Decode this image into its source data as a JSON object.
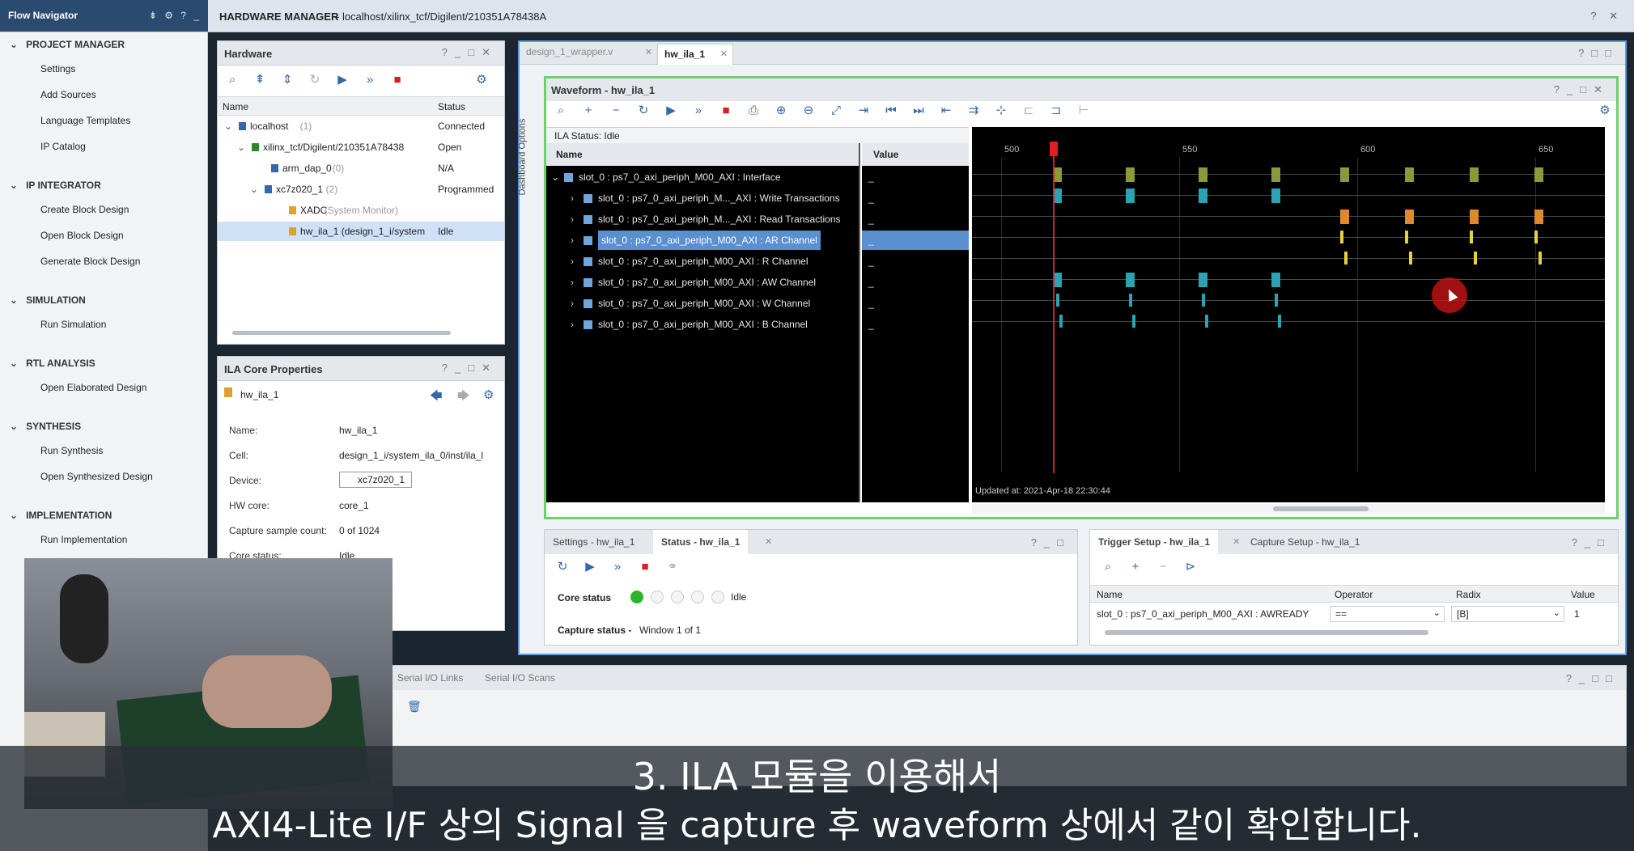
{
  "app": {
    "title_prefix": "HARDWARE MANAGER",
    "title_path": " - localhost/xilinx_tcf/Digilent/210351A78438A",
    "title_controls": "? ✕"
  },
  "flow_navigator": {
    "title": "Flow Navigator",
    "header_icons": "⇟ ⚙ ? _",
    "sections": [
      {
        "label": "PROJECT MANAGER",
        "items": [
          "Settings",
          "Add Sources",
          "Language Templates",
          "IP Catalog"
        ]
      },
      {
        "label": "IP INTEGRATOR",
        "items": [
          "Create Block Design",
          "Open Block Design",
          "Generate Block Design"
        ]
      },
      {
        "label": "SIMULATION",
        "items": [
          "Run Simulation"
        ]
      },
      {
        "label": "RTL ANALYSIS",
        "items": [
          "Open Elaborated Design"
        ]
      },
      {
        "label": "SYNTHESIS",
        "items": [
          "Run Synthesis",
          "Open Synthesized Design"
        ]
      },
      {
        "label": "IMPLEMENTATION",
        "items": [
          "Run Implementation"
        ]
      }
    ]
  },
  "hardware_panel": {
    "title": "Hardware",
    "col_name": "Name",
    "col_status": "Status",
    "rows": [
      {
        "name": "localhost",
        "count": "(1)",
        "status": "Connected"
      },
      {
        "name": "xilinx_tcf/Digilent/210351A78438",
        "count": "",
        "status": "Open"
      },
      {
        "name": "arm_dap_0",
        "count": "(0)",
        "status": "N/A"
      },
      {
        "name": "xc7z020_1",
        "count": "(2)",
        "status": "Programmed"
      },
      {
        "name": "XADC",
        "count": "(System Monitor)",
        "status": ""
      },
      {
        "name": "hw_ila_1 (design_1_i/system",
        "count": "",
        "status": "Idle"
      }
    ]
  },
  "ila_props": {
    "title": "ILA Core Properties",
    "name_header": "hw_ila_1",
    "fields": [
      {
        "label": "Name:",
        "value": "hw_ila_1"
      },
      {
        "label": "Cell:",
        "value": "design_1_i/system_ila_0/inst/ila_l"
      },
      {
        "label": "Device:",
        "value": "xc7z020_1"
      },
      {
        "label": "HW core:",
        "value": "core_1"
      },
      {
        "label": "Capture sample count:",
        "value": "0 of 1024"
      },
      {
        "label": "Core status:",
        "value": "Idle"
      }
    ]
  },
  "editor_tabs": [
    "design_1_wrapper.v",
    "hw_ila_1"
  ],
  "dashboard_label": "Dashboard Options",
  "waveform": {
    "title": "Waveform - hw_ila_1",
    "ila_status": "ILA Status:  Idle",
    "col_name": "Name",
    "col_value": "Value",
    "signals": [
      "slot_0 : ps7_0_axi_periph_M00_AXI : Interface",
      "slot_0 : ps7_0_axi_periph_M..._AXI : Write Transactions",
      "slot_0 : ps7_0_axi_periph_M..._AXI : Read Transactions",
      "slot_0 : ps7_0_axi_periph_M00_AXI : AR Channel",
      "slot_0 : ps7_0_axi_periph_M00_AXI : R Channel",
      "slot_0 : ps7_0_axi_periph_M00_AXI : AW Channel",
      "slot_0 : ps7_0_axi_periph_M00_AXI : W Channel",
      "slot_0 : ps7_0_axi_periph_M00_AXI : B Channel"
    ],
    "value_placeholder": "_",
    "ticks": [
      "500",
      "550",
      "600",
      "650"
    ],
    "updated": "Updated at:  2021-Apr-18 22:30:44"
  },
  "status_panel": {
    "tabs": [
      "Settings - hw_ila_1",
      "Status - hw_ila_1"
    ],
    "core_status_label": "Core status",
    "core_status_value": "Idle",
    "capture_status_label": "Capture status -",
    "capture_status_value": "Window 1 of 1"
  },
  "trigger_panel": {
    "tabs": [
      "Trigger Setup - hw_ila_1",
      "Capture Setup - hw_ila_1"
    ],
    "cols": [
      "Name",
      "Operator",
      "Radix",
      "Value"
    ],
    "row": {
      "name": "slot_0 : ps7_0_axi_periph_M00_AXI : AWREADY",
      "operator": "==",
      "radix": "[B]",
      "value": "1"
    }
  },
  "bottom_tabs": [
    "Serial I/O Links",
    "Serial I/O Scans"
  ],
  "subtitle": {
    "line1": "3. ILA 모듈을 이용해서",
    "line2": "AXI4-Lite I/F 상의 Signal 을 capture 후 waveform 상에서 같이 확인합니다."
  },
  "colors": {
    "accent": "#3568a6",
    "wave_green": "#8a9a3b",
    "wave_teal": "#2aa3b5",
    "wave_orange": "#e0892b",
    "wave_yellow": "#e6d23a",
    "marker_red": "#e02020"
  }
}
